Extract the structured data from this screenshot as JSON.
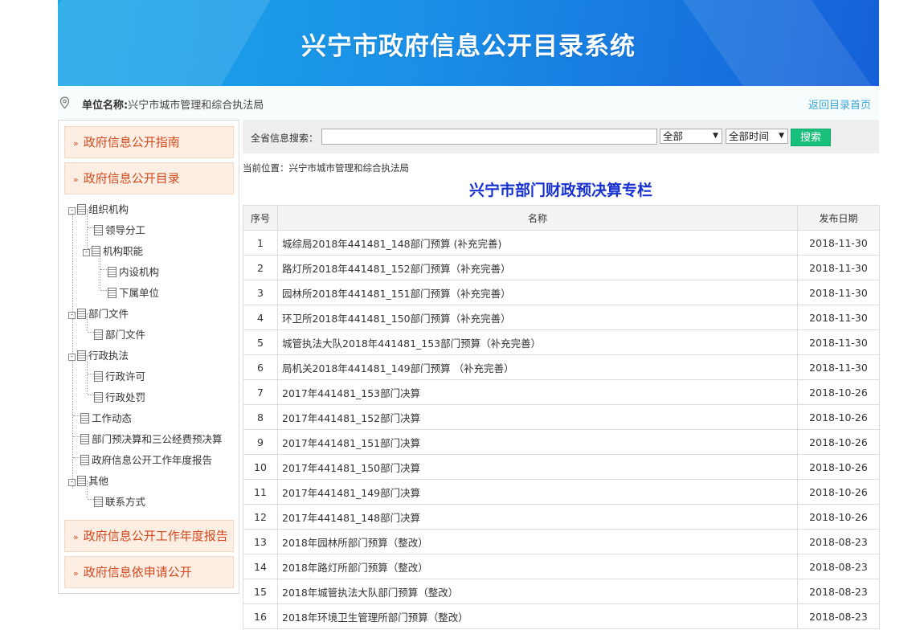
{
  "header": {
    "title": "兴宁市政府信息公开目录系统"
  },
  "unit_bar": {
    "label": "单位名称:",
    "value": "兴宁市城市管理和综合执法局",
    "back_link": "返回目录首页"
  },
  "sidebar": {
    "menu_top": [
      {
        "label": "政府信息公开指南"
      },
      {
        "label": "政府信息公开目录"
      }
    ],
    "tree": [
      {
        "label": "组织机构"
      },
      {
        "label": "领导分工"
      },
      {
        "label": "机构职能"
      },
      {
        "label": "内设机构"
      },
      {
        "label": "下属单位"
      },
      {
        "label": "部门文件"
      },
      {
        "label": "部门文件"
      },
      {
        "label": "行政执法"
      },
      {
        "label": "行政许可"
      },
      {
        "label": "行政处罚"
      },
      {
        "label": "工作动态"
      },
      {
        "label": "部门预决算和三公经费预决算"
      },
      {
        "label": "政府信息公开工作年度报告"
      },
      {
        "label": "其他"
      },
      {
        "label": "联系方式"
      }
    ],
    "menu_bottom": [
      {
        "label": "政府信息公开工作年度报告"
      },
      {
        "label": "政府信息依申请公开"
      }
    ]
  },
  "search": {
    "label": "全省信息搜索：",
    "input_value": "",
    "scope_selected": "全部",
    "time_selected": "全部时间",
    "button_label": "搜索"
  },
  "breadcrumb": {
    "prefix": "当前位置：",
    "current": "兴宁市城市管理和综合执法局"
  },
  "column_title": "兴宁市部门财政预决算专栏",
  "table": {
    "headers": {
      "num": "序号",
      "name": "名称",
      "date": "发布日期"
    },
    "rows": [
      {
        "num": "1",
        "name": "城综局2018年441481_148部门预算 (补充完善)",
        "date": "2018-11-30"
      },
      {
        "num": "2",
        "name": "路灯所2018年441481_152部门预算（补充完善）",
        "date": "2018-11-30"
      },
      {
        "num": "3",
        "name": "园林所2018年441481_151部门预算（补充完善）",
        "date": "2018-11-30"
      },
      {
        "num": "4",
        "name": "环卫所2018年441481_150部门预算（补充完善）",
        "date": "2018-11-30"
      },
      {
        "num": "5",
        "name": "城管执法大队2018年441481_153部门预算（补充完善）",
        "date": "2018-11-30"
      },
      {
        "num": "6",
        "name": "局机关2018年441481_149部门预算 （补充完善）",
        "date": "2018-11-30"
      },
      {
        "num": "7",
        "name": "2017年441481_153部门决算",
        "date": "2018-10-26"
      },
      {
        "num": "8",
        "name": "2017年441481_152部门决算",
        "date": "2018-10-26"
      },
      {
        "num": "9",
        "name": "2017年441481_151部门决算",
        "date": "2018-10-26"
      },
      {
        "num": "10",
        "name": "2017年441481_150部门决算",
        "date": "2018-10-26"
      },
      {
        "num": "11",
        "name": "2017年441481_149部门决算",
        "date": "2018-10-26"
      },
      {
        "num": "12",
        "name": "2017年441481_148部门决算",
        "date": "2018-10-26"
      },
      {
        "num": "13",
        "name": "2018年园林所部门预算（整改）",
        "date": "2018-08-23"
      },
      {
        "num": "14",
        "name": "2018年路灯所部门预算（整改）",
        "date": "2018-08-23"
      },
      {
        "num": "15",
        "name": "2018年城管执法大队部门预算（整改）",
        "date": "2018-08-23"
      },
      {
        "num": "16",
        "name": "2018年环境卫生管理所部门预算（整改）",
        "date": "2018-08-23"
      }
    ]
  }
}
